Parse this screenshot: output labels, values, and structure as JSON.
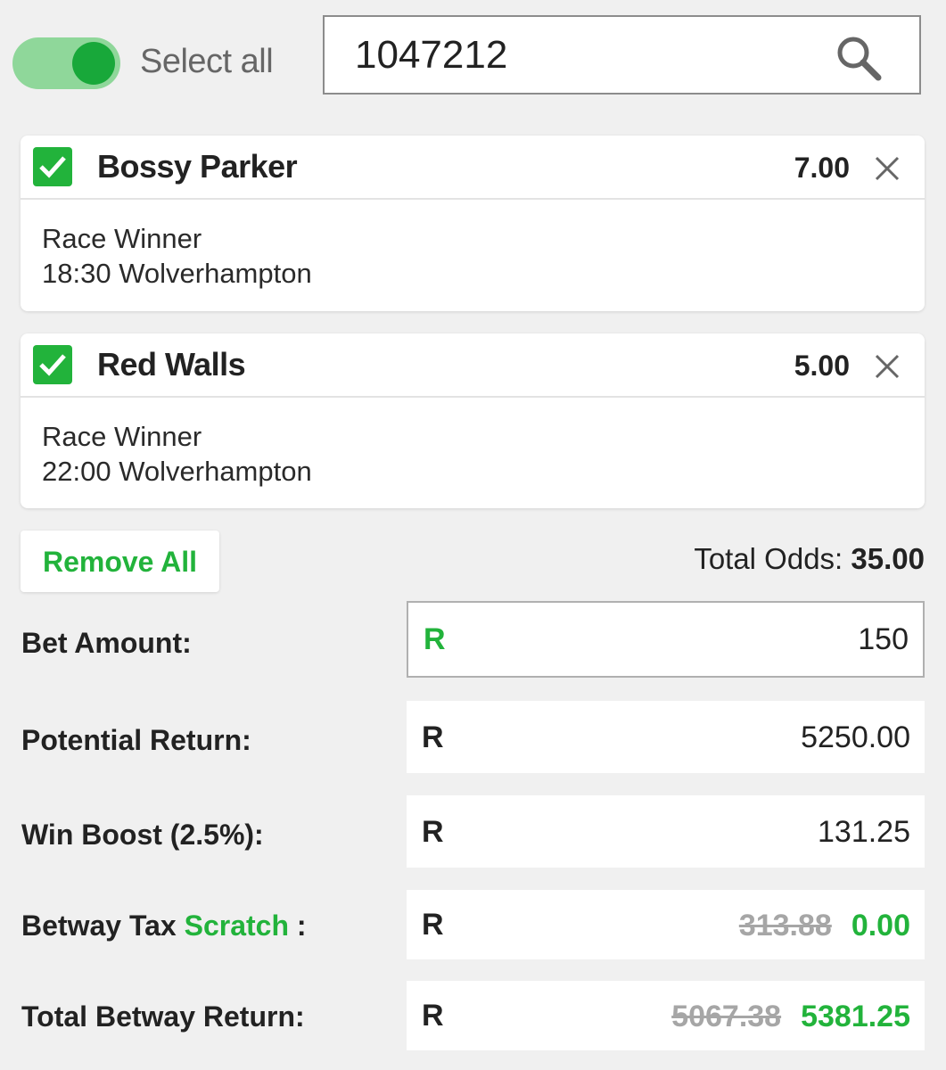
{
  "header": {
    "select_all_label": "Select all",
    "select_all_on": true,
    "search_value": "1047212"
  },
  "selections": [
    {
      "name": "Bossy Parker",
      "odds": "7.00",
      "market": "Race Winner",
      "event": "18:30 Wolverhampton",
      "checked": true
    },
    {
      "name": "Red Walls",
      "odds": "5.00",
      "market": "Race Winner",
      "event": "22:00 Wolverhampton",
      "checked": true
    }
  ],
  "summary": {
    "remove_all_label": "Remove All",
    "total_odds_label": "Total Odds:",
    "total_odds_value": "35.00"
  },
  "betslip": {
    "currency": "R",
    "bet_amount_label": "Bet Amount:",
    "bet_amount_value": "150",
    "potential_return_label": "Potential Return:",
    "potential_return_value": "5250.00",
    "win_boost_label": "Win Boost (2.5%):",
    "win_boost_value": "131.25",
    "tax_label_prefix": "Betway Tax",
    "tax_label_highlight": "Scratch",
    "tax_label_suffix": ":",
    "tax_old_value": "313.88",
    "tax_new_value": "0.00",
    "total_return_label": "Total Betway Return:",
    "total_return_old_value": "5067.38",
    "total_return_new_value": "5381.25"
  },
  "colors": {
    "accent_green": "#22b33b",
    "toggle_track": "#8fd79a",
    "background": "#f0f0f0"
  }
}
